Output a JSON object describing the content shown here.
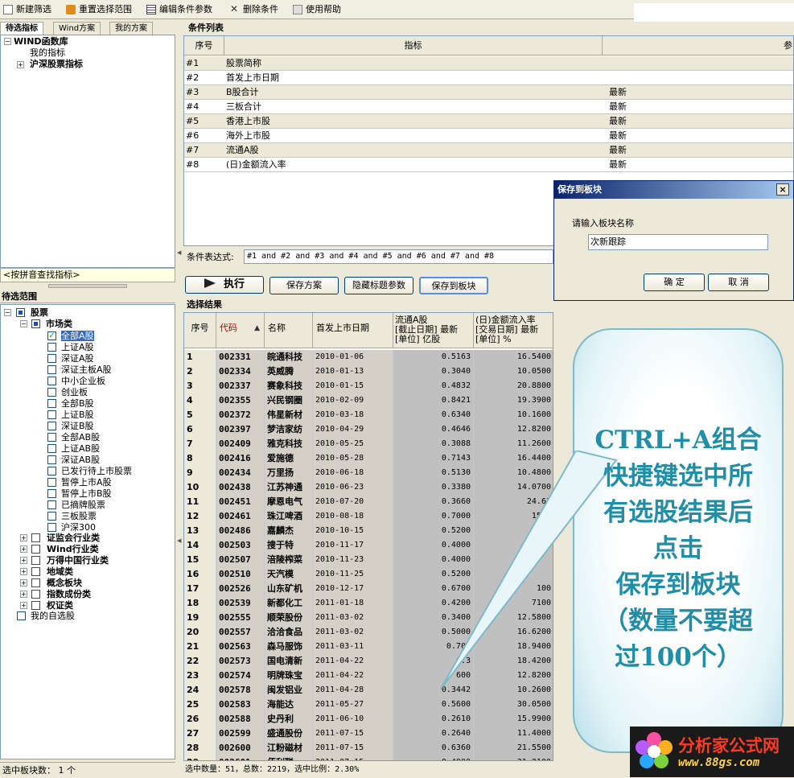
{
  "toolbar": {
    "items": [
      {
        "label": "新建筛选",
        "icon": "new-icon"
      },
      {
        "label": "重置选择范围",
        "icon": "reset-icon"
      },
      {
        "label": "编辑条件参数",
        "icon": "table-icon"
      },
      {
        "label": "删除条件",
        "icon": "delete-icon"
      },
      {
        "label": "使用帮助",
        "icon": "book-icon"
      }
    ]
  },
  "left": {
    "tabs": [
      "待选指标",
      "Wind方案",
      "我的方案"
    ],
    "tree": [
      "WIND函数库",
      "我的指标",
      "沪深股票指标"
    ],
    "pinyin_search": "<按拼音查找指标>",
    "range_title": "待选范围",
    "range_tree": {
      "root": "股票",
      "market": "市场类",
      "market_items": [
        "全部A股",
        "上证A股",
        "深证A股",
        "深证主板A股",
        "中小企业板",
        "创业板",
        "全部B股",
        "上证B股",
        "深证B股",
        "全部AB股",
        "上证AB股",
        "深证AB股",
        "已发行待上市股票",
        "暂停上市A股",
        "暂停上市B股",
        "已摘牌股票",
        "三板股票",
        "沪深300"
      ],
      "categories": [
        "证监会行业类",
        "Wind行业类",
        "万得中国行业类",
        "地域类",
        "概念板块",
        "指数成份类",
        "权证类"
      ],
      "mine": "我的自选股"
    },
    "status": "选中板块数： 1 个"
  },
  "conditions": {
    "title": "条件列表",
    "headers": {
      "idx": "序号",
      "indicator": "指标",
      "param": "参"
    },
    "rows": [
      {
        "idx": "#1",
        "indicator": "股票简称",
        "param": ""
      },
      {
        "idx": "#2",
        "indicator": "首发上市日期",
        "param": ""
      },
      {
        "idx": "#3",
        "indicator": "B股合计",
        "param": "最新"
      },
      {
        "idx": "#4",
        "indicator": "三板合计",
        "param": "最新"
      },
      {
        "idx": "#5",
        "indicator": "香港上市股",
        "param": "最新"
      },
      {
        "idx": "#6",
        "indicator": "海外上市股",
        "param": "最新"
      },
      {
        "idx": "#7",
        "indicator": "流通A股",
        "param": "最新"
      },
      {
        "idx": "#8",
        "indicator": "(日)金额流入率",
        "param": "最新"
      }
    ]
  },
  "expression": {
    "label": "条件表达式:",
    "value": "#1 and #2 and #3 and #4 and #5 and #6 and #7 and #8"
  },
  "buttons": {
    "execute": "执行",
    "save_plan": "保存方案",
    "hide_params": "隐藏标题参数",
    "save_block": "保存到板块"
  },
  "results": {
    "title": "选择结果",
    "headers": {
      "idx": "序号",
      "code": "代码",
      "name": "名称",
      "ipo": "首发上市日期",
      "float_l1": "流通A股",
      "float_l2": "[截止日期] 最新",
      "float_l3": "[单位] 亿股",
      "flow_l1": "(日)金额流入率",
      "flow_l2": "[交易日期] 最新",
      "flow_l3": "[单位] %"
    },
    "rows": [
      {
        "idx": "1",
        "code": "002331",
        "name": "皖通科技",
        "date": "2010-01-06",
        "v1": "0.5163",
        "v2": "16.5400"
      },
      {
        "idx": "2",
        "code": "002334",
        "name": "英威腾",
        "date": "2010-01-13",
        "v1": "0.3040",
        "v2": "10.0500"
      },
      {
        "idx": "3",
        "code": "002337",
        "name": "赛象科技",
        "date": "2010-01-15",
        "v1": "0.4832",
        "v2": "20.8800"
      },
      {
        "idx": "4",
        "code": "002355",
        "name": "兴民钢圈",
        "date": "2010-02-09",
        "v1": "0.8421",
        "v2": "19.3900"
      },
      {
        "idx": "5",
        "code": "002372",
        "name": "伟星新材",
        "date": "2010-03-18",
        "v1": "0.6340",
        "v2": "10.1600"
      },
      {
        "idx": "6",
        "code": "002397",
        "name": "梦洁家纺",
        "date": "2010-04-29",
        "v1": "0.4646",
        "v2": "12.8200"
      },
      {
        "idx": "7",
        "code": "002409",
        "name": "雅克科技",
        "date": "2010-05-25",
        "v1": "0.3088",
        "v2": "11.2600"
      },
      {
        "idx": "8",
        "code": "002416",
        "name": "爱施德",
        "date": "2010-05-28",
        "v1": "0.7143",
        "v2": "16.4400"
      },
      {
        "idx": "9",
        "code": "002434",
        "name": "万里扬",
        "date": "2010-06-18",
        "v1": "0.5130",
        "v2": "10.4800"
      },
      {
        "idx": "10",
        "code": "002438",
        "name": "江苏神通",
        "date": "2010-06-23",
        "v1": "0.3380",
        "v2": "14.0700"
      },
      {
        "idx": "11",
        "code": "002451",
        "name": "摩恩电气",
        "date": "2010-07-20",
        "v1": "0.3660",
        "v2": "24.63"
      },
      {
        "idx": "12",
        "code": "002461",
        "name": "珠江啤酒",
        "date": "2010-08-18",
        "v1": "0.7000",
        "v2": "15.0"
      },
      {
        "idx": "13",
        "code": "002486",
        "name": "嘉麟杰",
        "date": "2010-10-15",
        "v1": "0.5200",
        "v2": "23"
      },
      {
        "idx": "14",
        "code": "002503",
        "name": "搜于特",
        "date": "2010-11-17",
        "v1": "0.4000",
        "v2": ""
      },
      {
        "idx": "15",
        "code": "002507",
        "name": "涪陵榨菜",
        "date": "2010-11-23",
        "v1": "0.4000",
        "v2": ""
      },
      {
        "idx": "16",
        "code": "002510",
        "name": "天汽模",
        "date": "2010-11-25",
        "v1": "0.5200",
        "v2": ""
      },
      {
        "idx": "17",
        "code": "002526",
        "name": "山东矿机",
        "date": "2010-12-17",
        "v1": "0.6700",
        "v2": "100"
      },
      {
        "idx": "18",
        "code": "002539",
        "name": "新都化工",
        "date": "2011-01-18",
        "v1": "0.4200",
        "v2": "7100"
      },
      {
        "idx": "19",
        "code": "002555",
        "name": "顺荣股份",
        "date": "2011-03-02",
        "v1": "0.3400",
        "v2": "12.5800"
      },
      {
        "idx": "20",
        "code": "002557",
        "name": "洽洽食品",
        "date": "2011-03-02",
        "v1": "0.5000",
        "v2": "16.6200"
      },
      {
        "idx": "21",
        "code": "002563",
        "name": "森马服饰",
        "date": "2011-03-11",
        "v1": "0.700",
        "v2": "18.9400"
      },
      {
        "idx": "22",
        "code": "002573",
        "name": "国电清新",
        "date": "2011-04-22",
        "v1": "0.3",
        "v2": "18.4200"
      },
      {
        "idx": "23",
        "code": "002574",
        "name": "明牌珠宝",
        "date": "2011-04-22",
        "v1": "600",
        "v2": "12.8200"
      },
      {
        "idx": "24",
        "code": "002578",
        "name": "闽发铝业",
        "date": "2011-04-28",
        "v1": "0.3442",
        "v2": "10.2600"
      },
      {
        "idx": "25",
        "code": "002583",
        "name": "海能达",
        "date": "2011-05-27",
        "v1": "0.5600",
        "v2": "30.0500"
      },
      {
        "idx": "26",
        "code": "002588",
        "name": "史丹利",
        "date": "2011-06-10",
        "v1": "0.2610",
        "v2": "15.9900"
      },
      {
        "idx": "27",
        "code": "002599",
        "name": "盛通股份",
        "date": "2011-07-15",
        "v1": "0.2640",
        "v2": "11.4000"
      },
      {
        "idx": "28",
        "code": "002600",
        "name": "江粉磁材",
        "date": "2011-07-15",
        "v1": "0.6360",
        "v2": "21.5500"
      },
      {
        "idx": "29",
        "code": "002601",
        "name": "佰利联",
        "date": "2011-07-15",
        "v1": "0.4000",
        "v2": "21.2100"
      }
    ],
    "status": "选中数量：51，总数：2219，选中比例：2.30%"
  },
  "dialog": {
    "title": "保存到板块",
    "close": "×",
    "prompt": "请输入板块名称",
    "value": "次新跟踪",
    "ok": "确  定",
    "cancel": "取  消"
  },
  "callout": {
    "lines": [
      "CTRL+A组合",
      "快捷键选中所",
      "有选股结果后",
      "点击",
      "保存到板块",
      "（数量不要超",
      "过100个）"
    ]
  },
  "logo": {
    "title": "分析家公式网",
    "url": "www.88gs.com"
  },
  "colors": {
    "titlebar": "#0a246a",
    "callout_text": "#1f8ea6",
    "logo_title": "#ff3a1e",
    "code_header": "#c00000"
  }
}
